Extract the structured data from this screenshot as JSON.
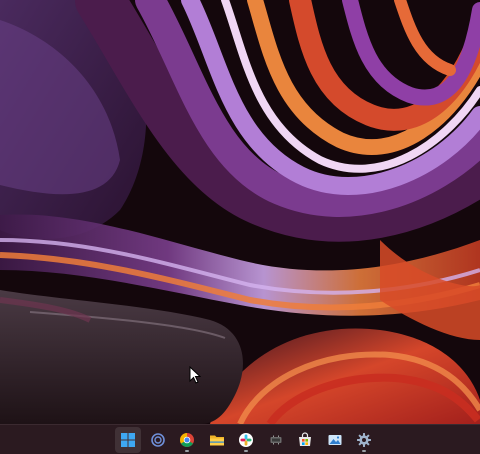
{
  "desktop": {
    "wallpaper": "windows-11-flow-wallpaper-sunrise",
    "colors": {
      "background": "#14070c",
      "purple": "#5a2f70",
      "lavender": "#a98ad6",
      "orange": "#e0562c",
      "red": "#b92a23"
    }
  },
  "taskbar": {
    "background": "#2b1a20",
    "items": [
      {
        "icon": "windows-start-icon",
        "running": false,
        "active": true
      },
      {
        "icon": "cortana-icon",
        "running": false
      },
      {
        "icon": "chrome-icon",
        "running": true
      },
      {
        "icon": "file-explorer-icon",
        "running": false
      },
      {
        "icon": "slack-icon",
        "running": true
      },
      {
        "icon": "terminal-chip-icon",
        "running": false
      },
      {
        "icon": "microsoft-store-icon",
        "running": false
      },
      {
        "icon": "photos-icon",
        "running": false
      },
      {
        "icon": "settings-gear-icon",
        "running": true
      }
    ]
  }
}
